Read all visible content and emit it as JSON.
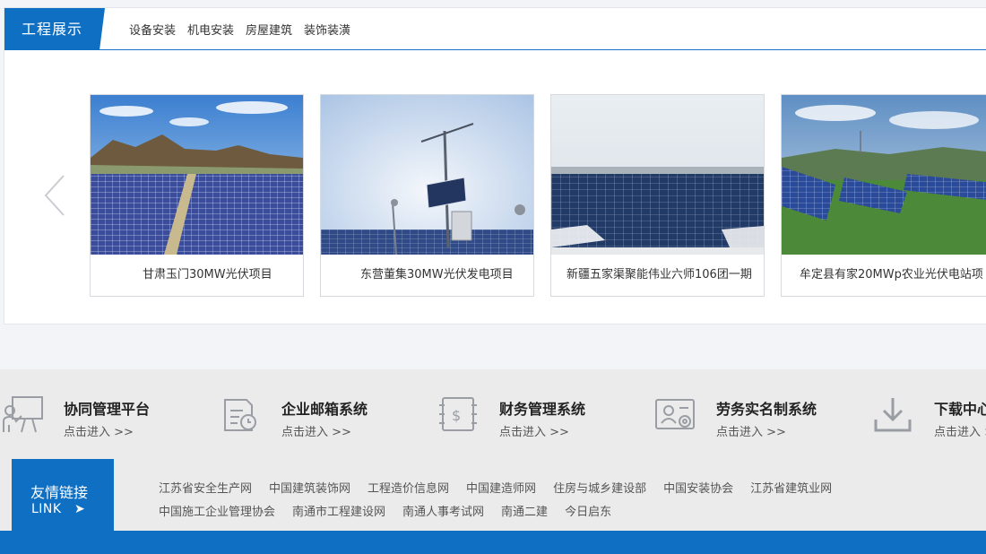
{
  "showcase": {
    "title": "工程展示",
    "tabs": [
      "设备安装",
      "机电安装",
      "房屋建筑",
      "装饰装潢"
    ],
    "projects": [
      {
        "caption": "甘肃玉门30MW光伏项目"
      },
      {
        "caption": "东营董集30MW光伏发电项目"
      },
      {
        "caption": "新疆五家渠聚能伟业六师106团一期"
      },
      {
        "caption": "牟定县有家20MWp农业光伏电站项"
      }
    ]
  },
  "platforms": [
    {
      "name": "协同管理平台",
      "enter": "点击进入 >>",
      "icon": "presentation-board-icon"
    },
    {
      "name": "企业邮箱系统",
      "enter": "点击进入 >>",
      "icon": "mail-document-icon"
    },
    {
      "name": "财务管理系统",
      "enter": "点击进入 >>",
      "icon": "finance-ledger-icon"
    },
    {
      "name": "劳务实名制系统",
      "enter": "点击进入 >>",
      "icon": "id-card-icon"
    },
    {
      "name": "下载中心",
      "enter": "点击进入 >>",
      "icon": "download-icon"
    }
  ],
  "friend_links": {
    "title": "友情链接",
    "subtitle": "LINK",
    "arrow": "➤",
    "row1": [
      "江苏省安全生产网",
      "中国建筑装饰网",
      "工程造价信息网",
      "中国建造师网",
      "住房与城乡建设部",
      "中国安装协会",
      "江苏省建筑业网"
    ],
    "row2": [
      "中国施工企业管理协会",
      "南通市工程建设网",
      "南通人事考试网",
      "南通二建",
      "今日启东"
    ]
  },
  "colors": {
    "brand_blue": "#0e6fc3",
    "band_gray": "#ebebeb",
    "page_bg": "#f2f4f7"
  }
}
